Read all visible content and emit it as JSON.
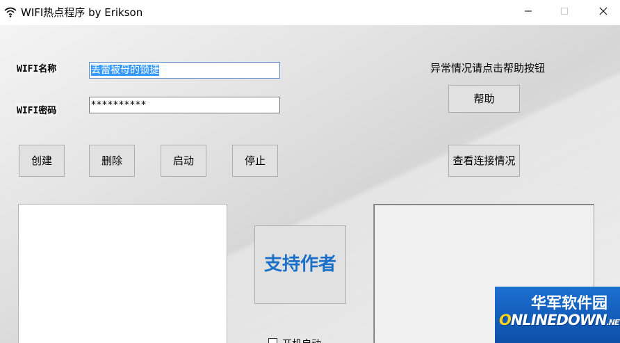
{
  "window": {
    "title": "WIFI热点程序 by Erikson",
    "minimize_icon": "minimize-icon",
    "maximize_icon": "maximize-icon",
    "close_icon": "close-icon"
  },
  "form": {
    "name_label": "WIFI名称",
    "name_value": "丢蕾被母的锁捷",
    "password_label": "WIFI密码",
    "password_value": "**********"
  },
  "buttons": {
    "create": "创建",
    "delete": "删除",
    "start": "启动",
    "stop": "停止",
    "help": "帮助",
    "view_connections": "查看连接情况",
    "support_author": "支持作者"
  },
  "notice": "异常情况请点击帮助按钮",
  "autostart_label": "开机启动",
  "watermark": {
    "chinese": "华军软件园",
    "english_o": "O",
    "english_rest": "NLINEDOWN",
    "english_suffix": ".NET"
  },
  "colors": {
    "accent_selection": "#3399ff",
    "support_text": "#1a6fc9",
    "watermark_bg": "#1c6fd0"
  }
}
